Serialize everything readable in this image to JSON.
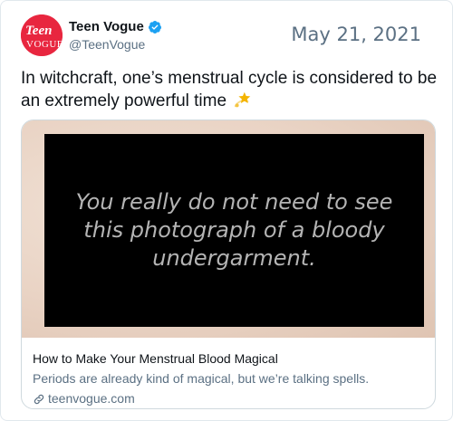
{
  "author": {
    "display_name": "Teen Vogue",
    "handle": "@TeenVogue",
    "avatar_label": "Teen Vogue",
    "verified_icon": "verified-badge-icon",
    "brand_color": "#e8263f"
  },
  "tweet": {
    "date": "May 21, 2021",
    "text": "In witchcraft, one’s menstrual cycle is considered to be an extremely powerful time",
    "emoji_icon": "dizzy-star-emoji-icon"
  },
  "card": {
    "image_overlay_text": "You really do not need to see this photograph of a bloody undergarment.",
    "title": "How to Make Your Menstrual Blood Magical",
    "description": "Periods are already kind of magical, but we’re talking spells.",
    "domain": "teenvogue.com",
    "link_icon": "link-icon"
  },
  "colors": {
    "verified_blue": "#1da1f2",
    "secondary_text": "#5b7083",
    "border": "#cfd9de"
  }
}
